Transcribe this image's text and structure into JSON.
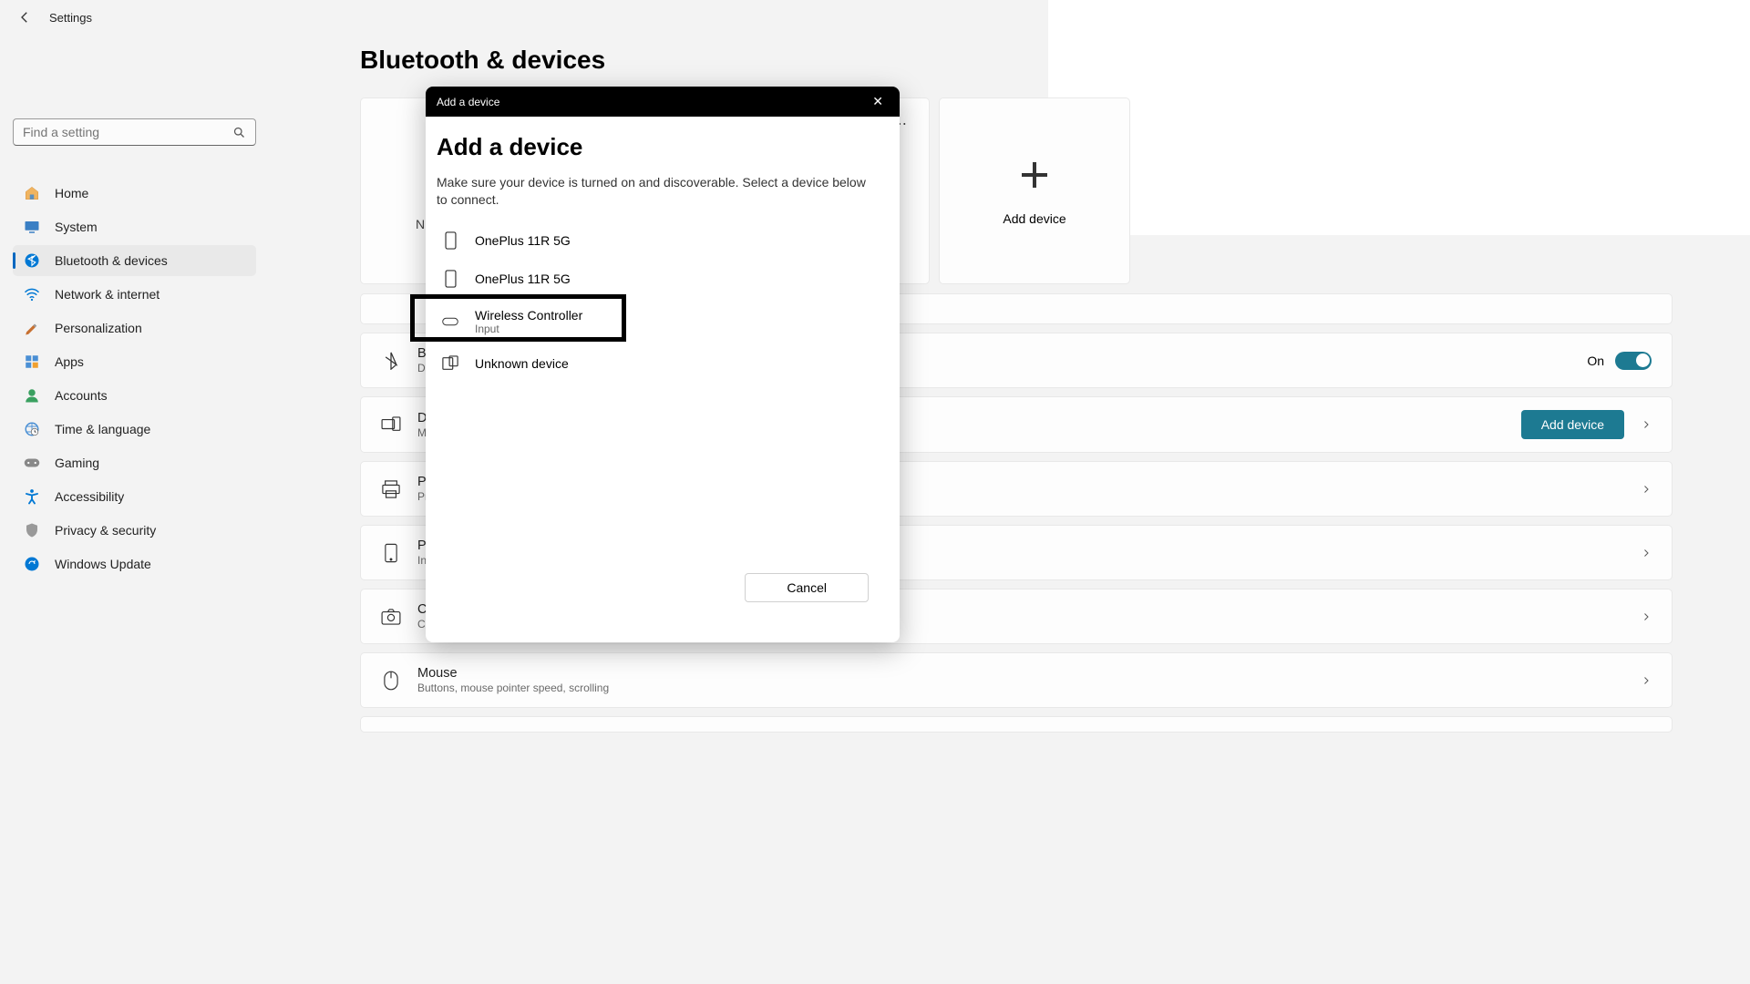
{
  "app": {
    "title": "Settings"
  },
  "search": {
    "placeholder": "Find a setting"
  },
  "nav": {
    "items": [
      {
        "label": "Home"
      },
      {
        "label": "System"
      },
      {
        "label": "Bluetooth & devices"
      },
      {
        "label": "Network & internet"
      },
      {
        "label": "Personalization"
      },
      {
        "label": "Apps"
      },
      {
        "label": "Accounts"
      },
      {
        "label": "Time & language"
      },
      {
        "label": "Gaming"
      },
      {
        "label": "Accessibility"
      },
      {
        "label": "Privacy & security"
      },
      {
        "label": "Windows Update"
      }
    ]
  },
  "page": {
    "title": "Bluetooth & devices"
  },
  "cards": {
    "card0_letter": "N",
    "add_label": "Add device"
  },
  "rows": {
    "bluetooth": {
      "title": "Bluetooth",
      "sub": "Discoverable",
      "state": "On"
    },
    "devices": {
      "title": "Devices",
      "sub": "Mouse, keyboard, pen, audio, displays and docks, other devices",
      "button": "Add device"
    },
    "printers": {
      "title": "Printers & scanners",
      "sub": "Preferences, troubleshoot"
    },
    "phone": {
      "title": "Phone Link",
      "sub": "Instantly access your mobile device's photos, texts, and more"
    },
    "cameras": {
      "title": "Cameras",
      "sub": "Connected cameras, default image settings"
    },
    "mouse": {
      "title": "Mouse",
      "sub": "Buttons, mouse pointer speed, scrolling"
    }
  },
  "dialog": {
    "titlebar": "Add a device",
    "heading": "Add a device",
    "desc": "Make sure your device is turned on and discoverable. Select a device below to connect.",
    "devices": [
      {
        "name": "OnePlus 11R 5G",
        "sub": ""
      },
      {
        "name": "OnePlus 11R 5G",
        "sub": ""
      },
      {
        "name": "Wireless Controller",
        "sub": "Input"
      },
      {
        "name": "Unknown device",
        "sub": ""
      }
    ],
    "cancel": "Cancel"
  }
}
